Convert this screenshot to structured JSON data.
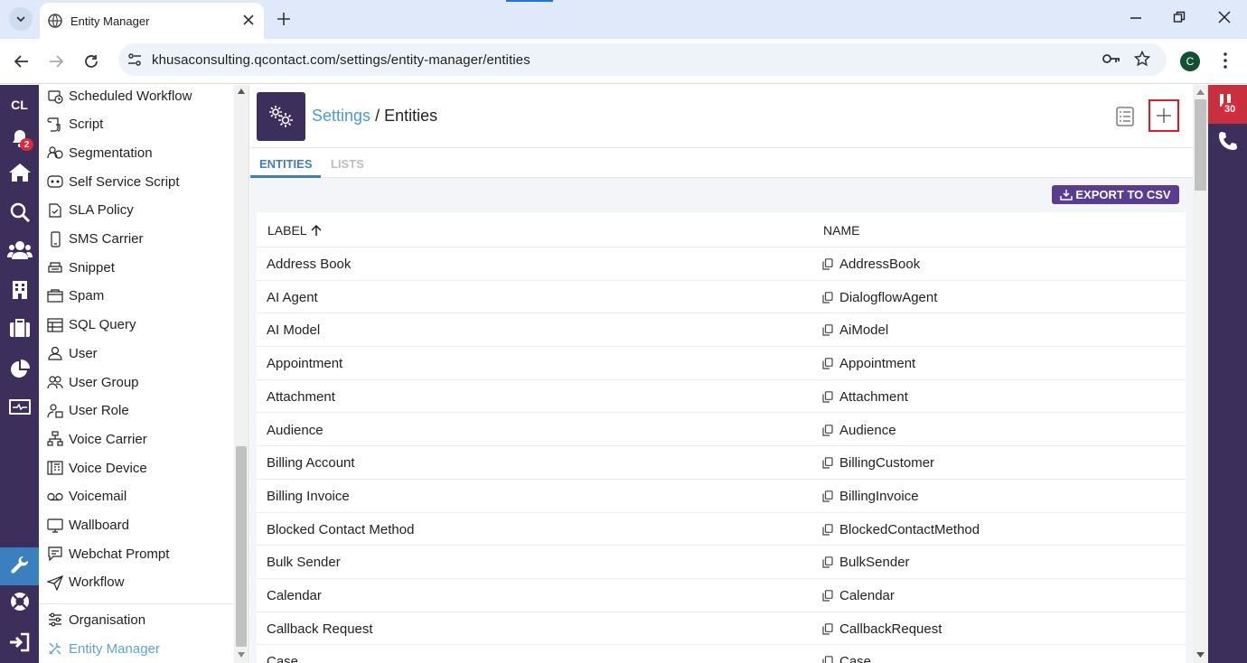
{
  "browser": {
    "tab_title": "Entity Manager",
    "url": "khusaconsulting.qcontact.com/settings/entity-manager/entities",
    "profile_initial": "C"
  },
  "rail": {
    "initials": "CL",
    "notification_count": "2",
    "icons": [
      "bell-icon",
      "home-icon",
      "search-icon",
      "people-icon",
      "building-icon",
      "briefcase-icon",
      "pie-chart-icon",
      "monitor-icon",
      "wrench-icon",
      "lifebuoy-icon",
      "logout-icon"
    ]
  },
  "nav": {
    "items": [
      {
        "label": "Scheduled Workflow",
        "icon": "scheduled-workflow-icon"
      },
      {
        "label": "Script",
        "icon": "script-icon"
      },
      {
        "label": "Segmentation",
        "icon": "segmentation-icon"
      },
      {
        "label": "Self Service Script",
        "icon": "self-service-script-icon"
      },
      {
        "label": "SLA Policy",
        "icon": "sla-policy-icon"
      },
      {
        "label": "SMS Carrier",
        "icon": "sms-carrier-icon"
      },
      {
        "label": "Snippet",
        "icon": "snippet-icon"
      },
      {
        "label": "Spam",
        "icon": "spam-icon"
      },
      {
        "label": "SQL Query",
        "icon": "sql-query-icon"
      },
      {
        "label": "User",
        "icon": "user-icon"
      },
      {
        "label": "User Group",
        "icon": "user-group-icon"
      },
      {
        "label": "User Role",
        "icon": "user-role-icon"
      },
      {
        "label": "Voice Carrier",
        "icon": "voice-carrier-icon"
      },
      {
        "label": "Voice Device",
        "icon": "voice-device-icon"
      },
      {
        "label": "Voicemail",
        "icon": "voicemail-icon"
      },
      {
        "label": "Wallboard",
        "icon": "wallboard-icon"
      },
      {
        "label": "Webchat Prompt",
        "icon": "webchat-prompt-icon"
      },
      {
        "label": "Workflow",
        "icon": "workflow-icon"
      }
    ],
    "organisation": "Organisation",
    "entity_manager": "Entity Manager"
  },
  "header": {
    "crumb_link": "Settings",
    "crumb_sep": "/",
    "crumb_current": "Entities"
  },
  "tabs": [
    "ENTITIES",
    "LISTS"
  ],
  "export_label": "EXPORT TO CSV",
  "table": {
    "columns": [
      "LABEL",
      "NAME"
    ],
    "rows": [
      [
        "Address Book",
        "AddressBook"
      ],
      [
        "AI Agent",
        "DialogflowAgent"
      ],
      [
        "AI Model",
        "AiModel"
      ],
      [
        "Appointment",
        "Appointment"
      ],
      [
        "Attachment",
        "Attachment"
      ],
      [
        "Audience",
        "Audience"
      ],
      [
        "Billing Account",
        "BillingCustomer"
      ],
      [
        "Billing Invoice",
        "BillingInvoice"
      ],
      [
        "Blocked Contact Method",
        "BlockedContactMethod"
      ],
      [
        "Bulk Sender",
        "BulkSender"
      ],
      [
        "Calendar",
        "Calendar"
      ],
      [
        "Callback Request",
        "CallbackRequest"
      ],
      [
        "Case",
        "Case"
      ]
    ]
  },
  "right_rail": {
    "badge": "30"
  },
  "colors": {
    "brand_purple": "#3d2f5c",
    "link_blue": "#4a9ad6",
    "export_button": "#5a3d91",
    "highlight_red": "#e0192d"
  }
}
